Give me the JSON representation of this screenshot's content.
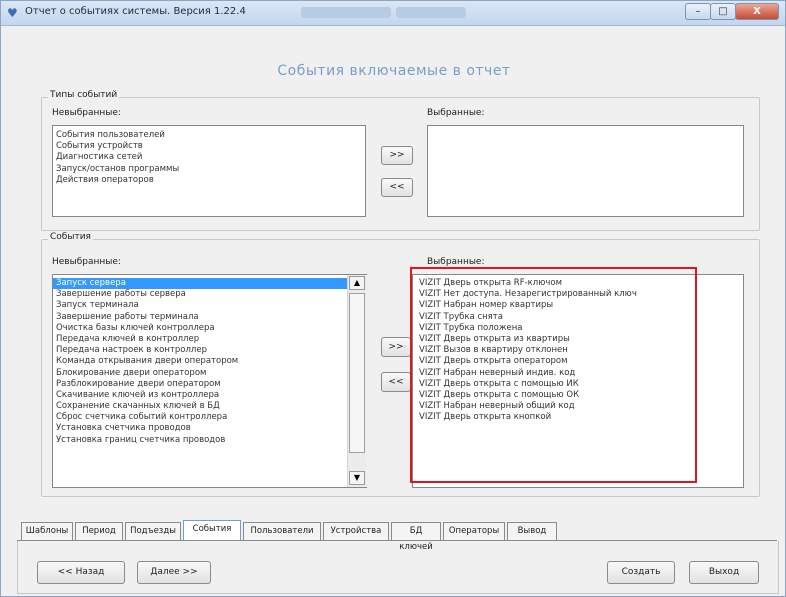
{
  "window": {
    "title": "Отчет о событиях системы. Версия 1.22.4",
    "icon": "app-heart-icon",
    "controls": {
      "minimize": "–",
      "maximize": "□",
      "close": "X"
    }
  },
  "heading": "События включаемые в отчет",
  "types_group": {
    "legend": "Типы событий",
    "unselected_label": "Невыбранные:",
    "selected_label": "Выбранные:",
    "unselected_items": [
      "События пользователей",
      "События устройств",
      "Диагностика сетей",
      "Запуск/останов программы",
      "Действия операторов"
    ],
    "selected_items": [],
    "add_label": ">>",
    "remove_label": "<<"
  },
  "events_group": {
    "legend": "События",
    "unselected_label": "Невыбранные:",
    "selected_label": "Выбранные:",
    "unselected_items": [
      "Запуск сервера",
      "Завершение работы сервера",
      "Запуск терминала",
      "Завершение работы терминала",
      "Очистка базы ключей контроллера",
      "Передача ключей в контроллер",
      "Передача настроек в контроллер",
      "Команда открывания двери оператором",
      "Блокирование двери оператором",
      "Разблокирование двери оператором",
      "Скачивание ключей из контроллера",
      "Сохранение скачанных ключей в БД",
      "Сброс счетчика событий контроллера",
      "Установка счетчика проводов",
      "Установка границ счетчика проводов"
    ],
    "selected_index": 0,
    "selected_items": [
      "VIZIT  Дверь открыта RF-ключом",
      "VIZIT  Нет доступа. Незарегистрированный ключ",
      "VIZIT  Набран номер квартиры",
      "VIZIT  Трубка снята",
      "VIZIT  Трубка положена",
      "VIZIT  Дверь открыта из квартиры",
      "VIZIT  Вызов в квартиру отклонен",
      "VIZIT  Дверь открыта оператором",
      "VIZIT  Набран неверный индив. код",
      "VIZIT  Дверь открыта с помощью ИК",
      "VIZIT  Дверь открыта с помощью ОК",
      "VIZIT  Набран неверный общий код",
      "VIZIT  Дверь открыта кнопкой"
    ],
    "add_label": ">>",
    "remove_label": "<<",
    "scroll_up": "▲",
    "scroll_down": "▼"
  },
  "tabs": [
    "Шаблоны",
    "Период",
    "Подъезды",
    "События",
    "Пользователи",
    "Устройства",
    "БД ключей",
    "Операторы",
    "Вывод"
  ],
  "active_tab": "События",
  "nav": {
    "back": "<< Назад",
    "next": "Далее >>",
    "create": "Создать",
    "exit": "Выход"
  },
  "highlight_color": "#e0161f",
  "selection_color": "#3399ff"
}
